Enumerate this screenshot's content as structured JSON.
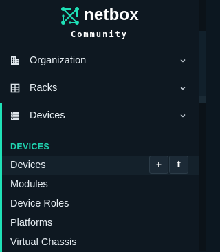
{
  "brand": {
    "name": "netbox",
    "edition": "Community"
  },
  "nav": [
    {
      "label": "Organization",
      "icon": "domain-icon"
    },
    {
      "label": "Racks",
      "icon": "rack-icon"
    },
    {
      "label": "Devices",
      "icon": "server-icon"
    }
  ],
  "devices_section": {
    "title": "DEVICES",
    "items": [
      "Devices",
      "Modules",
      "Device Roles",
      "Platforms",
      "Virtual Chassis"
    ],
    "add_symbol": "+",
    "import_symbol": "⬆"
  },
  "colors": {
    "accent": "#1fe1b7",
    "section": "#20d3b0",
    "background": "#0e1821"
  }
}
